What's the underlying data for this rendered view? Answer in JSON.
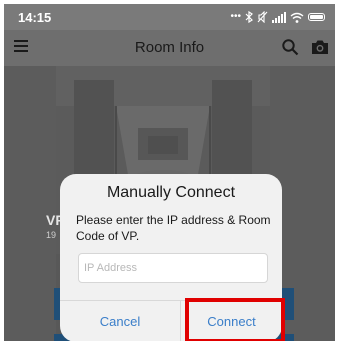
{
  "status_bar": {
    "time": "14:15",
    "icons": [
      "more-dots-icon",
      "bluetooth-icon",
      "silent-icon",
      "signal-icon",
      "wifi-icon",
      "battery-icon"
    ]
  },
  "app_bar": {
    "title": "Room Info",
    "icons": [
      "menu-icon",
      "search-icon",
      "camera-icon"
    ]
  },
  "background": {
    "vp_label": "VP",
    "vp_sub": "19"
  },
  "dialog": {
    "title": "Manually Connect",
    "message": "Please enter the IP address & Room Code of VP.",
    "ip_input": {
      "placeholder": "IP Address",
      "value": ""
    },
    "cancel_label": "Cancel",
    "connect_label": "Connect"
  },
  "colors": {
    "accent_blue": "#3a7ec9",
    "highlight_red": "#e00000",
    "dialog_bg": "#f1f1f1"
  }
}
